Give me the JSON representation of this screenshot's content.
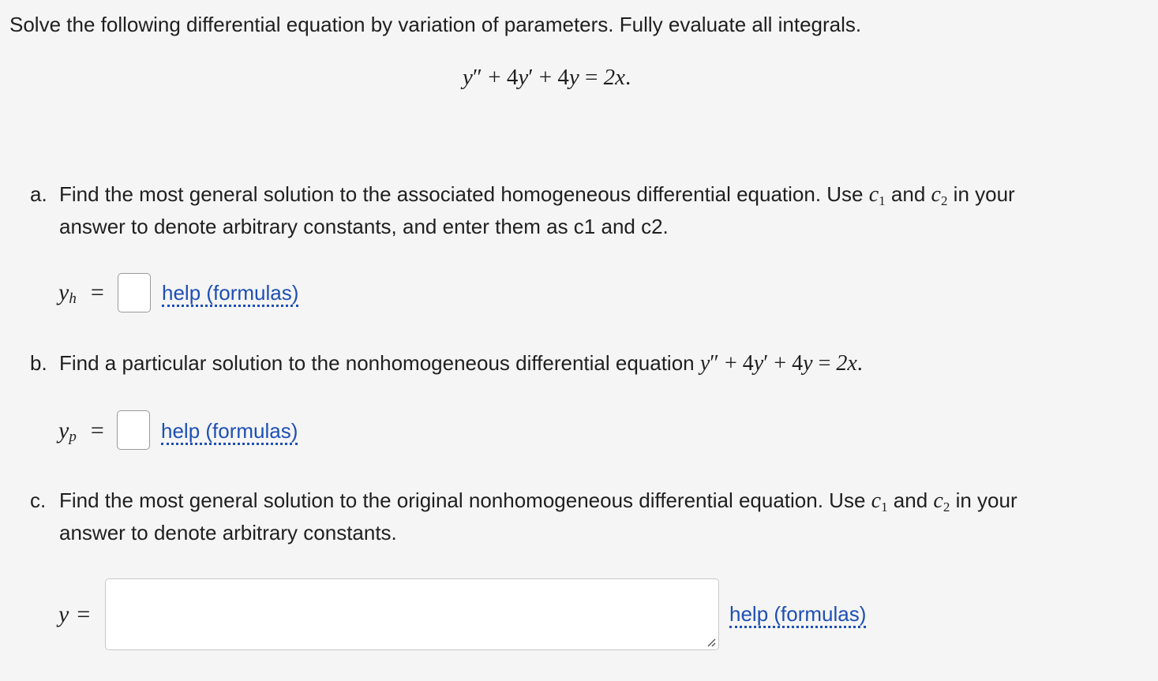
{
  "instructions": "Solve the following differential equation by variation of parameters. Fully evaluate all integrals.",
  "equation": {
    "y": "y",
    "double_prime": "″",
    "prime": "′",
    "plus": "+",
    "coef": "4",
    "equals": "=",
    "rhs": "2x",
    "period": "."
  },
  "part_a": {
    "letter": "a.",
    "text_1": "Find the most general solution to the associated homogeneous differential equation. Use ",
    "c1": "c",
    "c1_sub": "1",
    "and": " and ",
    "c2": "c",
    "c2_sub": "2",
    "text_2": " in your",
    "line_2": "answer to denote arbitrary constants, and enter them as c1 and c2.",
    "label_var": "y",
    "label_sub": "h",
    "label_eq": "=",
    "input_value": "",
    "help": "help (formulas)"
  },
  "part_b": {
    "letter": "b.",
    "text": "Find a particular solution to the nonhomogeneous differential equation ",
    "label_var": "y",
    "label_sub": "p",
    "label_eq": "=",
    "input_value": "",
    "help": "help (formulas)"
  },
  "part_c": {
    "letter": "c.",
    "text_1": "Find the most general solution to the original nonhomogeneous differential equation. Use ",
    "c1": "c",
    "c1_sub": "1",
    "and": " and ",
    "c2": "c",
    "c2_sub": "2",
    "text_2": " in your",
    "line_2": "answer to denote arbitrary constants.",
    "label_var": "y",
    "label_eq": "=",
    "input_value": "",
    "help": "help (formulas)"
  }
}
